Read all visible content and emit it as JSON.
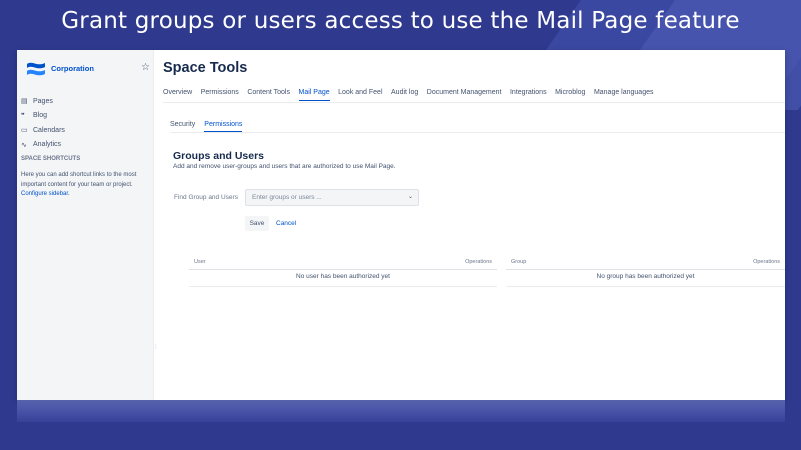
{
  "banner": {
    "title": "Grant groups or users access to use the Mail Page feature"
  },
  "sidebar": {
    "space_name": "Corporation",
    "items": [
      {
        "icon": "pages-icon",
        "glyph": "▤",
        "label": "Pages"
      },
      {
        "icon": "blog-icon",
        "glyph": "❞",
        "label": "Blog"
      },
      {
        "icon": "calendar-icon",
        "glyph": "▭",
        "label": "Calendars"
      },
      {
        "icon": "analytics-icon",
        "glyph": "∿",
        "label": "Analytics"
      }
    ],
    "shortcuts_title": "SPACE SHORTCUTS",
    "shortcuts_text": "Here you can add shortcut links to the most important content for your team or project.",
    "shortcuts_link": "Configure sidebar."
  },
  "main": {
    "title": "Space Tools",
    "tabs": [
      "Overview",
      "Permissions",
      "Content Tools",
      "Mail Page",
      "Look and Feel",
      "Audit log",
      "Document Management",
      "Integrations",
      "Microblog",
      "Manage languages"
    ],
    "active_tab": "Mail Page",
    "subtabs": [
      "Security",
      "Permissions"
    ],
    "active_subtab": "Permissions",
    "section_title": "Groups and Users",
    "section_desc": "Add and remove user-groups and users that are authorized to use Mail Page.",
    "find_label": "Find Group and Users",
    "find_placeholder": "Enter groups or users ...",
    "save_label": "Save",
    "cancel_label": "Cancel",
    "user_table": {
      "col1": "User",
      "col2": "Operations",
      "empty": "No user has been authorized yet"
    },
    "group_table": {
      "col1": "Group",
      "col2": "Operations",
      "empty": "No group has been authorized yet"
    }
  },
  "colors": {
    "accent": "#0052cc",
    "background": "#2f3a8f"
  }
}
